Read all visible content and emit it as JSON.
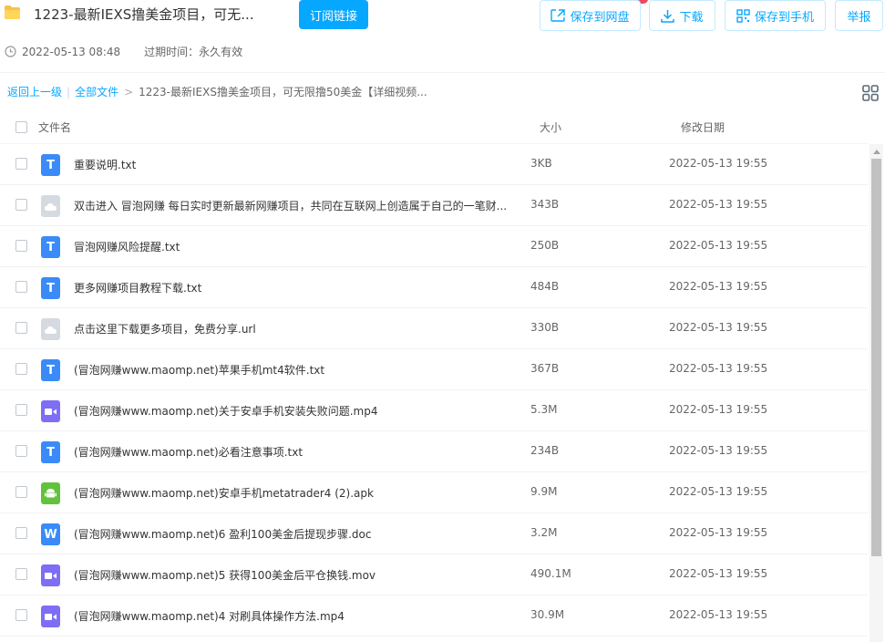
{
  "header": {
    "title": "1223-最新IEXS撸美金项目，可无...",
    "subscribe_label": "订阅链接",
    "share_time": "2022-05-13 08:48",
    "expire_text": "过期时间：永久有效",
    "buttons": {
      "save_to_netdisk": "保存到网盘",
      "download": "下载",
      "save_to_phone": "保存到手机",
      "report": "举报"
    }
  },
  "breadcrumb": {
    "back": "返回上一级",
    "all_files": "全部文件",
    "current": "1223-最新IEXS撸美金项目，可无限撸50美金【详细视频..."
  },
  "table": {
    "headers": {
      "name": "文件名",
      "size": "大小",
      "date": "修改日期"
    },
    "rows": [
      {
        "type": "txt",
        "icon_text": "T",
        "name": "重要说明.txt",
        "size": "3KB",
        "date": "2022-05-13 19:55"
      },
      {
        "type": "url",
        "icon_text": "",
        "name": "双击进入 冒泡网赚 每日实时更新最新网赚项目，共同在互联网上创造属于自己的一笔财...",
        "size": "343B",
        "date": "2022-05-13 19:55"
      },
      {
        "type": "txt",
        "icon_text": "T",
        "name": "冒泡网赚风险提醒.txt",
        "size": "250B",
        "date": "2022-05-13 19:55"
      },
      {
        "type": "txt",
        "icon_text": "T",
        "name": "更多网赚项目教程下载.txt",
        "size": "484B",
        "date": "2022-05-13 19:55"
      },
      {
        "type": "url",
        "icon_text": "",
        "name": "点击这里下载更多项目，免费分享.url",
        "size": "330B",
        "date": "2022-05-13 19:55"
      },
      {
        "type": "txt",
        "icon_text": "T",
        "name": "(冒泡网赚www.maomp.net)苹果手机mt4软件.txt",
        "size": "367B",
        "date": "2022-05-13 19:55"
      },
      {
        "type": "mp4",
        "icon_text": "",
        "name": "(冒泡网赚www.maomp.net)关于安卓手机安装失败问题.mp4",
        "size": "5.3M",
        "date": "2022-05-13 19:55"
      },
      {
        "type": "txt",
        "icon_text": "T",
        "name": "(冒泡网赚www.maomp.net)必看注意事项.txt",
        "size": "234B",
        "date": "2022-05-13 19:55"
      },
      {
        "type": "apk",
        "icon_text": "",
        "name": "(冒泡网赚www.maomp.net)安卓手机metatrader4 (2).apk",
        "size": "9.9M",
        "date": "2022-05-13 19:55"
      },
      {
        "type": "doc",
        "icon_text": "W",
        "name": "(冒泡网赚www.maomp.net)6 盈利100美金后提现步骤.doc",
        "size": "3.2M",
        "date": "2022-05-13 19:55"
      },
      {
        "type": "mp4",
        "icon_text": "",
        "name": "(冒泡网赚www.maomp.net)5 获得100美金后平仓换钱.mov",
        "size": "490.1M",
        "date": "2022-05-13 19:55"
      },
      {
        "type": "mp4",
        "icon_text": "",
        "name": "(冒泡网赚www.maomp.net)4 对刷具体操作方法.mp4",
        "size": "30.9M",
        "date": "2022-05-13 19:55"
      }
    ]
  },
  "colors": {
    "accent": "#06a7ff",
    "txt_icon": "#3a8bf8",
    "video_icon": "#7e6ef5",
    "apk_icon": "#62c23c",
    "url_icon": "#d5dae0"
  }
}
